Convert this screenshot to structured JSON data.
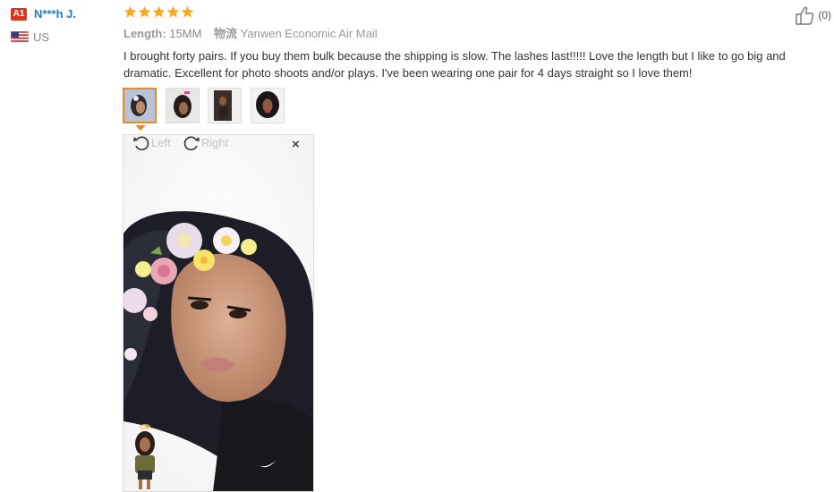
{
  "reviewer": {
    "level_badge": "A1",
    "name": "N***h J.",
    "country": "US",
    "flag_icon": "us-flag-icon"
  },
  "rating": {
    "stars": 5,
    "max": 5,
    "color": "#f5a623"
  },
  "meta": {
    "length_label": "Length:",
    "length_value": "15MM",
    "logistics_label": "物流",
    "shipping_value": "Yanwen Economic Air Mail"
  },
  "review_text": "I brought forty pairs. If you buy them bulk because the shipping is slow. The lashes last!!!!! Love the length but I like to go big and dramatic. Excellent for photo shoots and/or plays. I've been wearing one pair for 4 days straight so I love them!",
  "helpful": {
    "icon": "thumbs-up-icon",
    "count": "(0)"
  },
  "photos": {
    "thumbnail_count": 4,
    "active_index": 0,
    "rotate_left_label": "Left",
    "rotate_right_label": "Right",
    "close_symbol": "×"
  },
  "colors": {
    "accent": "#e78a2c",
    "username": "#1a7fc1",
    "badge": "#d9381e"
  }
}
